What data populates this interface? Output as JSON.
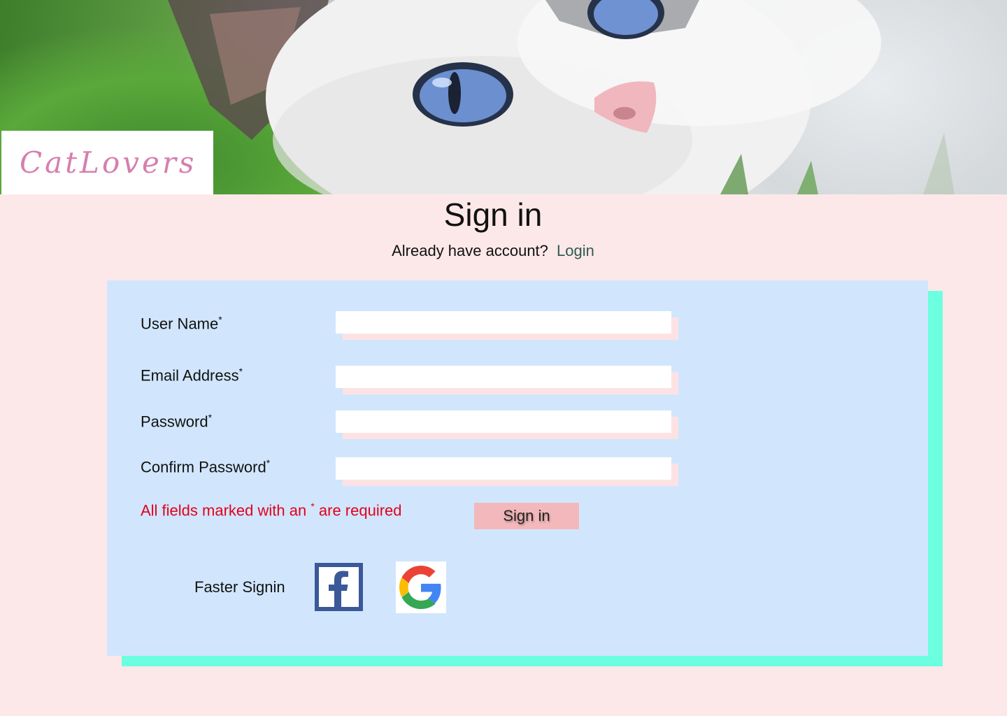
{
  "header": {
    "logo_text": "CatLovers",
    "banner_image": "white-kitten-photo"
  },
  "intro": {
    "title": "Sign in",
    "prompt": "Already have account?",
    "login_link": "Login"
  },
  "form": {
    "fields": [
      {
        "label": "User Name",
        "required_mark": "*",
        "value": ""
      },
      {
        "label": "Email Address",
        "required_mark": "*",
        "value": ""
      },
      {
        "label": "Password",
        "required_mark": "*",
        "value": ""
      },
      {
        "label": "Confirm Password",
        "required_mark": "*",
        "value": ""
      }
    ],
    "required_note_start": "All fields marked with an ",
    "required_note_mark": "*",
    "required_note_end": " are required",
    "submit_label": "Sign in"
  },
  "social": {
    "label": "Faster Signin",
    "facebook_icon": "facebook-icon",
    "google_icon": "google-icon"
  },
  "colors": {
    "page_background": "#fde8e9",
    "card_background": "#d1e6fd",
    "card_shadow": "#6cffdf",
    "logo_text": "#d67fae",
    "required_text": "#e3001b",
    "login_link": "#2f5a53",
    "submit_button": "#f3b8bb",
    "facebook_blue": "#3b5998"
  }
}
